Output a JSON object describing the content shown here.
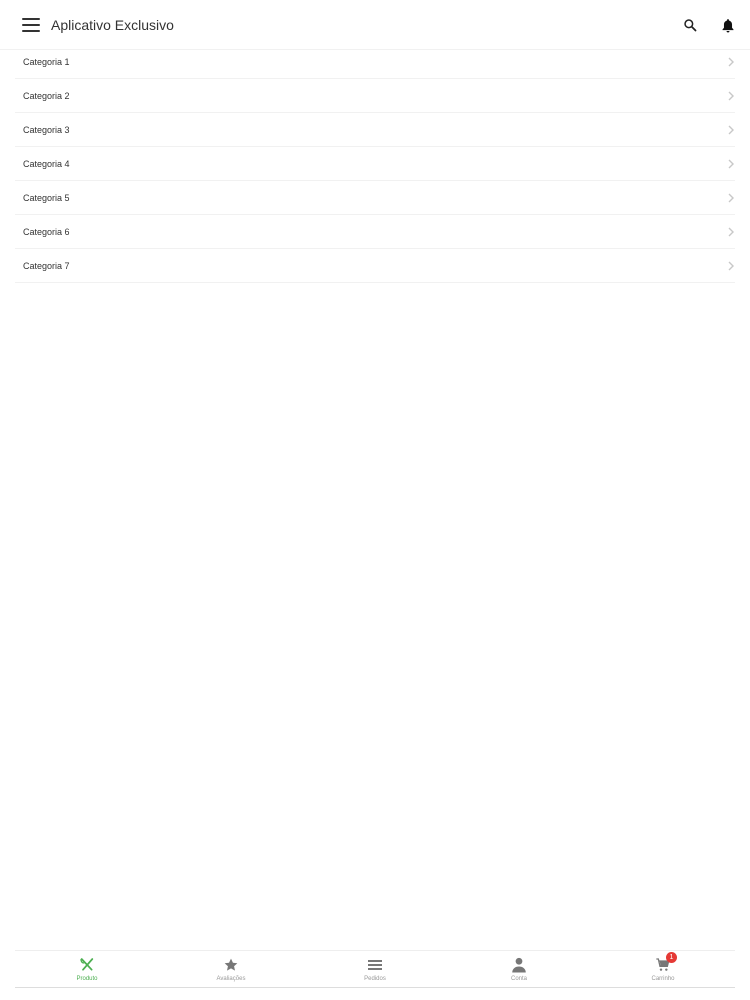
{
  "header": {
    "title": "Aplicativo Exclusivo",
    "icons": [
      "menu-icon",
      "search-icon",
      "bell-icon"
    ]
  },
  "categories": [
    {
      "label": "Categoria 1"
    },
    {
      "label": "Categoria 2"
    },
    {
      "label": "Categoria 3"
    },
    {
      "label": "Categoria 4"
    },
    {
      "label": "Categoria 5"
    },
    {
      "label": "Categoria 6"
    },
    {
      "label": "Categoria 7"
    }
  ],
  "bottom_nav": {
    "items": [
      {
        "label": "Produto",
        "icon": "utensils-icon",
        "active": true
      },
      {
        "label": "Avaliações",
        "icon": "star-icon"
      },
      {
        "label": "Pedidos",
        "icon": "list-icon"
      },
      {
        "label": "Conta",
        "icon": "person-icon"
      },
      {
        "label": "Carrinho",
        "icon": "cart-icon"
      }
    ],
    "cart_badge": "1"
  },
  "colors": {
    "accent": "#4caf50",
    "badge": "#e53935",
    "text": "#333333",
    "muted": "#999999"
  }
}
